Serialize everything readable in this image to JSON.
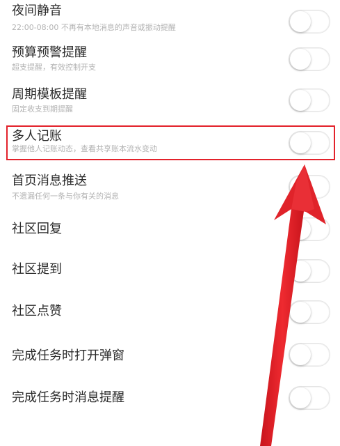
{
  "settings": [
    {
      "title": "夜间静音",
      "subtitle": "22:00-08:00 不再有本地消息的声音或振动提醒",
      "enabled": false
    },
    {
      "title": "预算预警提醒",
      "subtitle": "超支提醒，有效控制开支",
      "enabled": false
    },
    {
      "title": "周期模板提醒",
      "subtitle": "固定收支到期提醒",
      "enabled": false
    },
    {
      "title": "多人记账",
      "subtitle": "掌握他人记账动态，查看共享账本流水变动",
      "enabled": false
    },
    {
      "title": "首页消息推送",
      "subtitle": "不遗漏任何一条与你有关的消息",
      "enabled": false
    },
    {
      "title": "社区回复",
      "subtitle": "",
      "enabled": false
    },
    {
      "title": "社区提到",
      "subtitle": "",
      "enabled": false
    },
    {
      "title": "社区点赞",
      "subtitle": "",
      "enabled": false
    },
    {
      "title": "完成任务时打开弹窗",
      "subtitle": "",
      "enabled": false
    },
    {
      "title": "完成任务时消息提醒",
      "subtitle": "",
      "enabled": false
    }
  ],
  "annotation": {
    "highlight_color": "#e3222b",
    "highlighted_item": "多人记账"
  }
}
